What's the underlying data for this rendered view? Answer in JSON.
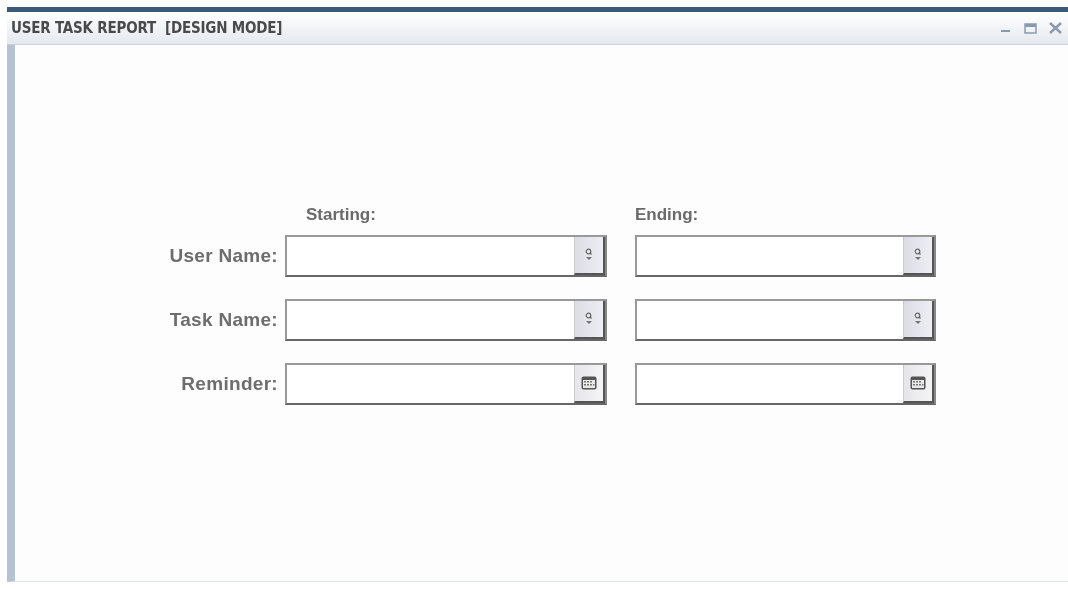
{
  "window": {
    "title": "USER TASK REPORT  [DESIGN MODE]"
  },
  "columns": [
    "Starting:",
    "Ending:"
  ],
  "rows": [
    {
      "label": "User Name:",
      "kind": "lookup"
    },
    {
      "label": "Task Name:",
      "kind": "lookup"
    },
    {
      "label": "Reminder:",
      "kind": "date"
    }
  ]
}
